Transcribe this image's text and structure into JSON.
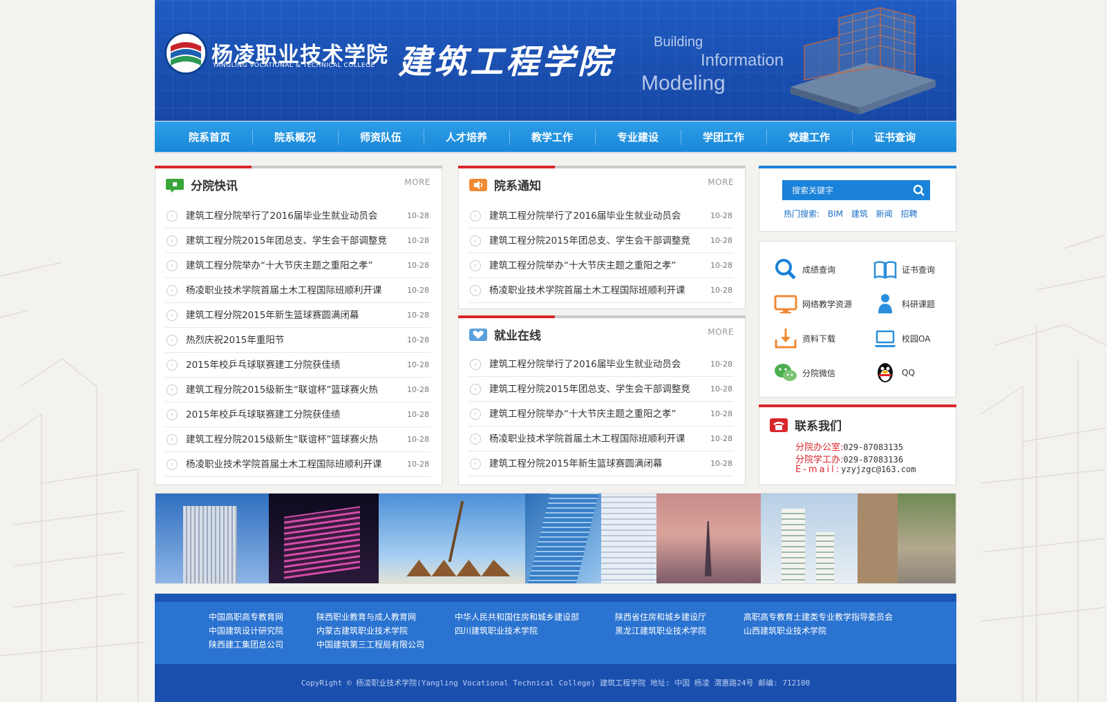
{
  "header": {
    "college_name": "杨凌职业技术学院",
    "college_en": "YANGLING VOCATIONAL & TECHNICAL COLLEGE",
    "school_name": "建筑工程学院",
    "bim_words": [
      "Building",
      "Information",
      "Modeling"
    ]
  },
  "nav": {
    "items": [
      "院系首页",
      "院系概况",
      "师资队伍",
      "人才培养",
      "教学工作",
      "专业建设",
      "学团工作",
      "党建工作",
      "证书查询"
    ]
  },
  "news_panel": {
    "title": "分院快讯",
    "more": "MORE",
    "items": [
      {
        "title": "建筑工程分院举行了2016届毕业生就业动员会",
        "date": "10-28"
      },
      {
        "title": "建筑工程分院2015年团总支、学生会干部调整竞",
        "date": "10-28"
      },
      {
        "title": "建筑工程分院举办“十大节庆主题之重阳之孝”",
        "date": "10-28"
      },
      {
        "title": "杨凌职业技术学院首届土木工程国际班顺利开课",
        "date": "10-28"
      },
      {
        "title": "建筑工程分院2015年新生篮球赛圆满闭幕",
        "date": "10-28"
      },
      {
        "title": "热烈庆祝2015年重阳节",
        "date": "10-28"
      },
      {
        "title": "2015年校乒乓球联赛建工分院获佳绩",
        "date": "10-28"
      },
      {
        "title": "建筑工程分院2015级新生“联谊杯”篮球赛火热",
        "date": "10-28"
      },
      {
        "title": "2015年校乒乓球联赛建工分院获佳绩",
        "date": "10-28"
      },
      {
        "title": "建筑工程分院2015级新生“联谊杯”篮球赛火热",
        "date": "10-28"
      },
      {
        "title": "杨凌职业技术学院首届土木工程国际班顺利开课",
        "date": "10-28"
      }
    ]
  },
  "notice_panel": {
    "title": "院系通知",
    "more": "MORE",
    "items": [
      {
        "title": "建筑工程分院举行了2016届毕业生就业动员会",
        "date": "10-28"
      },
      {
        "title": "建筑工程分院2015年团总支、学生会干部调整竞",
        "date": "10-28"
      },
      {
        "title": "建筑工程分院举办“十大节庆主题之重阳之孝”",
        "date": "10-28"
      },
      {
        "title": "杨凌职业技术学院首届土木工程国际班顺利开课",
        "date": "10-28"
      }
    ]
  },
  "job_panel": {
    "title": "就业在线",
    "more": "MORE",
    "items": [
      {
        "title": "建筑工程分院举行了2016届毕业生就业动员会",
        "date": "10-28"
      },
      {
        "title": "建筑工程分院2015年团总支、学生会干部调整竞",
        "date": "10-28"
      },
      {
        "title": "建筑工程分院举办“十大节庆主题之重阳之孝”",
        "date": "10-28"
      },
      {
        "title": "杨凌职业技术学院首届土木工程国际班顺利开课",
        "date": "10-28"
      },
      {
        "title": "建筑工程分院2015年新生篮球赛圆满闭幕",
        "date": "10-28"
      }
    ]
  },
  "search": {
    "placeholder": "搜索关键字",
    "hot_label": "热门搜索:",
    "hot_terms": [
      "BIM",
      "建筑",
      "新闻",
      "招聘"
    ]
  },
  "quick_links": [
    {
      "label": "成绩查询",
      "icon": "magnifier-icon"
    },
    {
      "label": "证书查询",
      "icon": "book-icon"
    },
    {
      "label": "网络教学资源",
      "icon": "monitor-icon"
    },
    {
      "label": "科研课题",
      "icon": "person-icon"
    },
    {
      "label": "资料下载",
      "icon": "download-icon"
    },
    {
      "label": "校园OA",
      "icon": "laptop-icon"
    },
    {
      "label": "分院微信",
      "icon": "wechat-icon"
    },
    {
      "label": "QQ",
      "icon": "qq-penguin-icon"
    }
  ],
  "contact": {
    "title": "联系我们",
    "lines": [
      {
        "label": "分院办公室:",
        "value": "029-87083135"
      },
      {
        "label": "分院学工办:",
        "value": "029-87083136"
      },
      {
        "label": "E-mail:",
        "value": "yzyjzgc@163.com"
      }
    ]
  },
  "footer_links": [
    [
      "中国高职高专教育网",
      "中国建筑设计研究院",
      "陕西建工集团总公司"
    ],
    [
      "陕西职业教育与成人教育网",
      "内蒙古建筑职业技术学院",
      "中国建筑第三工程局有限公司"
    ],
    [
      "中华人民共和国住房和城乡建设部",
      "四川建筑职业技术学院"
    ],
    [
      "陕西省住房和城乡建设厅",
      "黑龙江建筑职业技术学院"
    ],
    [
      "高职高专教育土建类专业教学指导委员会",
      "山西建筑职业技术学院"
    ]
  ],
  "copyright": "CopyRight © 杨凌职业技术学院(Yangling Vocational Technical College) 建筑工程学院    地址: 中国 杨凌 渭惠路24号 邮编: 712100",
  "colors": {
    "header_blue": "#1f5cc4",
    "nav_blue": "#1888d8",
    "accent_red": "#d9262b",
    "link_blue": "#1a6fc4"
  }
}
